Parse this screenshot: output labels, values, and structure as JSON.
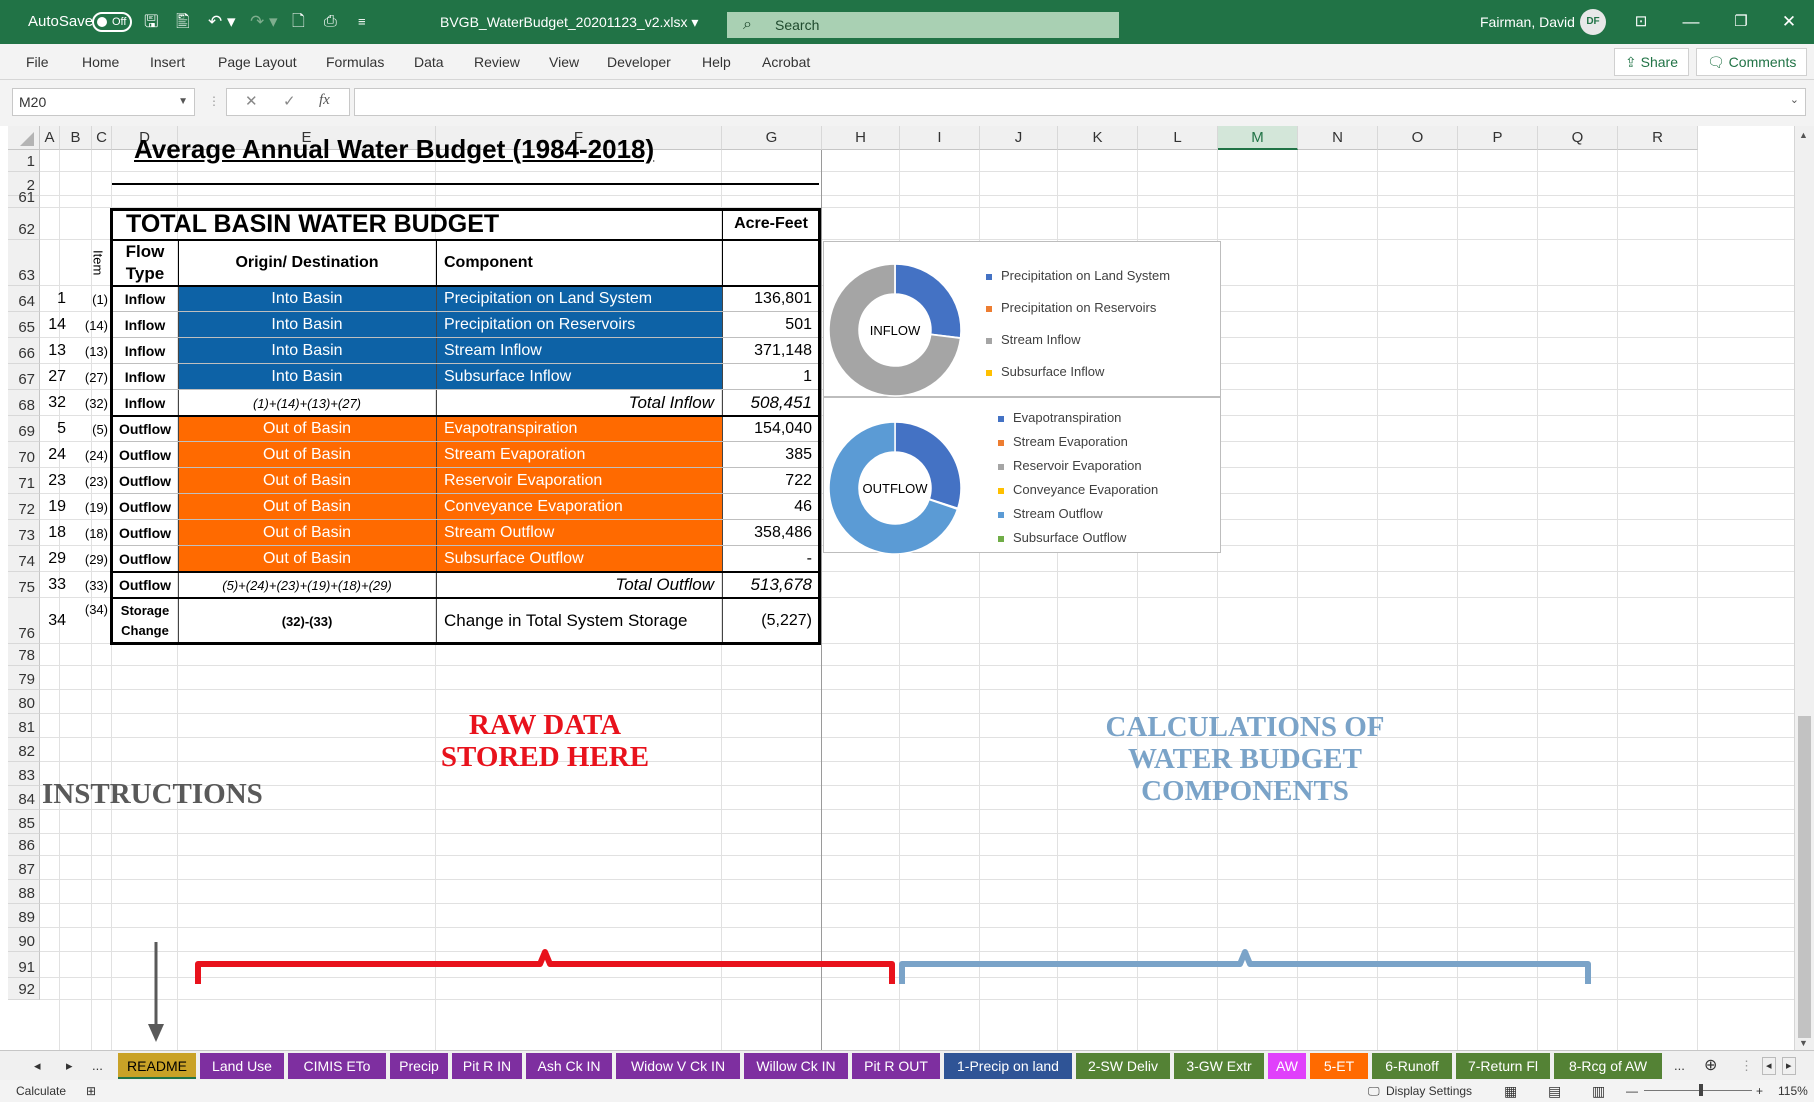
{
  "titlebar": {
    "autosave_label": "AutoSave",
    "autosave_state": "Off",
    "filename": "BVGB_WaterBudget_20201123_v2.xlsx",
    "search_placeholder": "Search",
    "user_name": "Fairman, David",
    "user_initials": "DF"
  },
  "ribbon": {
    "tabs": [
      "File",
      "Home",
      "Insert",
      "Page Layout",
      "Formulas",
      "Data",
      "Review",
      "View",
      "Developer",
      "Help",
      "Acrobat"
    ],
    "share_label": "Share",
    "comments_label": "Comments"
  },
  "formula_bar": {
    "name_box": "M20",
    "fx_symbol": "fx",
    "cancel_symbol": "✕",
    "enter_symbol": "✓",
    "value": ""
  },
  "columns": [
    "A",
    "B",
    "C",
    "D",
    "E",
    "F",
    "G",
    "H",
    "I",
    "J",
    "K",
    "L",
    "M",
    "N",
    "O",
    "P",
    "Q",
    "R"
  ],
  "selected_column": "M",
  "rows": [
    "1",
    "2",
    "61",
    "62",
    "63",
    "64",
    "65",
    "66",
    "67",
    "68",
    "69",
    "70",
    "71",
    "72",
    "73",
    "74",
    "75",
    "76",
    "78",
    "79",
    "80",
    "81",
    "82",
    "83",
    "84",
    "85",
    "86",
    "87",
    "88",
    "89",
    "90",
    "91",
    "92"
  ],
  "sheet": {
    "title": "Average Annual Water Budget (1984-2018)",
    "table_title": "TOTAL BASIN WATER BUDGET",
    "unit_label": "Acre-Feet",
    "headers": {
      "item": "Item",
      "flow_type": "Flow Type",
      "origin": "Origin/ Destination",
      "component": "Component"
    },
    "table_rows": [
      {
        "a": "1",
        "b": "(1)",
        "flow": "Inflow",
        "origin": "Into Basin",
        "component": "Precipitation on Land System",
        "value": "136,801",
        "style": "blue"
      },
      {
        "a": "14",
        "b": "(14)",
        "flow": "Inflow",
        "origin": "Into Basin",
        "component": "Precipitation on Reservoirs",
        "value": "501",
        "style": "blue"
      },
      {
        "a": "13",
        "b": "(13)",
        "flow": "Inflow",
        "origin": "Into Basin",
        "component": "Stream Inflow",
        "value": "371,148",
        "style": "blue"
      },
      {
        "a": "27",
        "b": "(27)",
        "flow": "Inflow",
        "origin": "Into Basin",
        "component": "Subsurface Inflow",
        "value": "1",
        "style": "blue"
      },
      {
        "a": "32",
        "b": "(32)",
        "flow": "Inflow",
        "origin": "(1)+(14)+(13)+(27)",
        "component": "Total Inflow",
        "value": "508,451",
        "style": "total"
      },
      {
        "a": "5",
        "b": "(5)",
        "flow": "Outflow",
        "origin": "Out of Basin",
        "component": "Evapotranspiration",
        "value": "154,040",
        "style": "orange"
      },
      {
        "a": "24",
        "b": "(24)",
        "flow": "Outflow",
        "origin": "Out of Basin",
        "component": "Stream Evaporation",
        "value": "385",
        "style": "orange"
      },
      {
        "a": "23",
        "b": "(23)",
        "flow": "Outflow",
        "origin": "Out of Basin",
        "component": "Reservoir Evaporation",
        "value": "722",
        "style": "orange"
      },
      {
        "a": "19",
        "b": "(19)",
        "flow": "Outflow",
        "origin": "Out of Basin",
        "component": "Conveyance Evaporation",
        "value": "46",
        "style": "orange"
      },
      {
        "a": "18",
        "b": "(18)",
        "flow": "Outflow",
        "origin": "Out of Basin",
        "component": "Stream Outflow",
        "value": "358,486",
        "style": "orange"
      },
      {
        "a": "29",
        "b": "(29)",
        "flow": "Outflow",
        "origin": "Out of Basin",
        "component": "Subsurface Outflow",
        "value": "-",
        "style": "orange"
      },
      {
        "a": "33",
        "b": "(33)",
        "flow": "Outflow",
        "origin": "(5)+(24)+(23)+(19)+(18)+(29)",
        "component": "Total Outflow",
        "value": "513,678",
        "style": "total"
      },
      {
        "a": "34",
        "b": "(34)",
        "flow": "Storage Change",
        "origin": "(32)-(33)",
        "component": "Change in Total System Storage",
        "value": "(5,227)",
        "style": "storage"
      }
    ]
  },
  "chart_data": [
    {
      "type": "pie",
      "title": "INFLOW",
      "categories": [
        "Precipitation on Land System",
        "Precipitation on Reservoirs",
        "Stream Inflow",
        "Subsurface Inflow"
      ],
      "values": [
        136801,
        501,
        371148,
        1
      ],
      "colors": [
        "#4472c4",
        "#ed7d31",
        "#a5a5a5",
        "#ffc000"
      ],
      "legend": "right"
    },
    {
      "type": "pie",
      "title": "OUTFLOW",
      "categories": [
        "Evapotranspiration",
        "Stream Evaporation",
        "Reservoir Evaporation",
        "Conveyance Evaporation",
        "Stream Outflow",
        "Subsurface Outflow"
      ],
      "values": [
        154040,
        385,
        722,
        46,
        358486,
        0
      ],
      "colors": [
        "#4472c4",
        "#ed7d31",
        "#a5a5a5",
        "#ffc000",
        "#5b9bd5",
        "#70ad47"
      ],
      "legend": "right"
    }
  ],
  "annotations": {
    "raw_data_line1": "RAW DATA",
    "raw_data_line2": "STORED HERE",
    "calc_line1": "CALCULATIONS OF",
    "calc_line2": "WATER BUDGET",
    "calc_line3": "COMPONENTS",
    "instructions": "INSTRUCTIONS",
    "raw_color": "#e8121c",
    "calc_color": "#7aa3c8",
    "instructions_color": "#595959"
  },
  "sheet_tabs": [
    {
      "label": "README",
      "color": "#c9a227",
      "text": "#000000",
      "active": true
    },
    {
      "label": "Land Use",
      "color": "#7e2fa0",
      "text": "#ffffff"
    },
    {
      "label": "CIMIS ETo",
      "color": "#7e2fa0",
      "text": "#ffffff"
    },
    {
      "label": "Precip",
      "color": "#7e2fa0",
      "text": "#ffffff"
    },
    {
      "label": "Pit R IN",
      "color": "#7e2fa0",
      "text": "#ffffff"
    },
    {
      "label": "Ash Ck IN",
      "color": "#7e2fa0",
      "text": "#ffffff"
    },
    {
      "label": "Widow V Ck IN",
      "color": "#7e2fa0",
      "text": "#ffffff"
    },
    {
      "label": "Willow Ck IN",
      "color": "#7e2fa0",
      "text": "#ffffff"
    },
    {
      "label": "Pit R OUT",
      "color": "#7e2fa0",
      "text": "#ffffff"
    },
    {
      "label": "1-Precip on land",
      "color": "#2f5496",
      "text": "#ffffff"
    },
    {
      "label": "2-SW Deliv",
      "color": "#548235",
      "text": "#ffffff"
    },
    {
      "label": "3-GW Extr",
      "color": "#548235",
      "text": "#ffffff"
    },
    {
      "label": "AW",
      "color": "#e040fb",
      "text": "#ffffff"
    },
    {
      "label": "5-ET",
      "color": "#ff6a00",
      "text": "#ffffff"
    },
    {
      "label": "6-Runoff",
      "color": "#548235",
      "text": "#ffffff"
    },
    {
      "label": "7-Return Fl",
      "color": "#548235",
      "text": "#ffffff"
    },
    {
      "label": "8-Rcg of AW",
      "color": "#548235",
      "text": "#ffffff"
    }
  ],
  "tabs_more": "...",
  "statusbar": {
    "mode": "Calculate",
    "display_settings": "Display Settings",
    "zoom": "115%",
    "zoom_level": 1.15
  }
}
